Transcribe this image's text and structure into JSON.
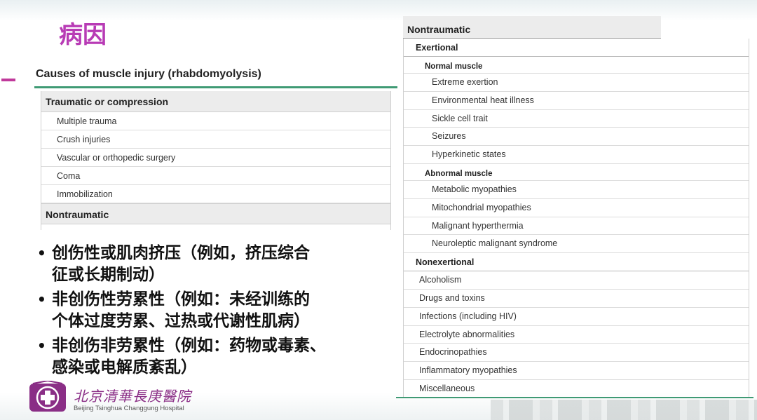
{
  "slide": {
    "title": "病因",
    "table_caption": "Causes of muscle injury (rhabdomyolysis)"
  },
  "left_table": {
    "header1": "Traumatic or compression",
    "rows": [
      "Multiple trauma",
      "Crush injuries",
      "Vascular or orthopedic surgery",
      "Coma",
      "Immobilization"
    ],
    "header2": "Nontraumatic"
  },
  "right_table": {
    "top_header": "Nontraumatic",
    "exertional": "Exertional",
    "normal_muscle": "Normal muscle",
    "normal_items": [
      "Extreme exertion",
      "Environmental heat illness",
      "Sickle cell trait",
      "Seizures",
      "Hyperkinetic states"
    ],
    "abnormal_muscle": "Abnormal muscle",
    "abnormal_items": [
      "Metabolic myopathies",
      "Mitochondrial myopathies",
      "Malignant hyperthermia",
      "Neuroleptic malignant syndrome"
    ],
    "nonexertional": "Nonexertional",
    "nonex_items": [
      "Alcoholism",
      "Drugs and toxins",
      "Infections (including HIV)",
      "Electrolyte abnormalities",
      "Endocrinopathies",
      "Inflammatory myopathies",
      "Miscellaneous"
    ]
  },
  "bullets": [
    {
      "line1": "创伤性或肌肉挤压（例如，挤压综合",
      "line2": "征或长期制动）"
    },
    {
      "line1": "非创伤性劳累性（例如：未经训练的",
      "line2": "个体过度劳累、过热或代谢性肌病）"
    },
    {
      "line1": "非创伤非劳累性（例如：药物或毒素、",
      "line2": "感染或电解质紊乱）"
    }
  ],
  "bullet_symbol": "•",
  "logo": {
    "name_cn": "北京清華長庚醫院",
    "name_en": "Beijing Tsinghua Changgung Hospital",
    "icon": "hospital-cross-logo-icon"
  },
  "colors": {
    "title": "#b83bb5",
    "rule": "#3f9a74",
    "header_bg": "#ececec",
    "logo": "#8a2e86"
  }
}
